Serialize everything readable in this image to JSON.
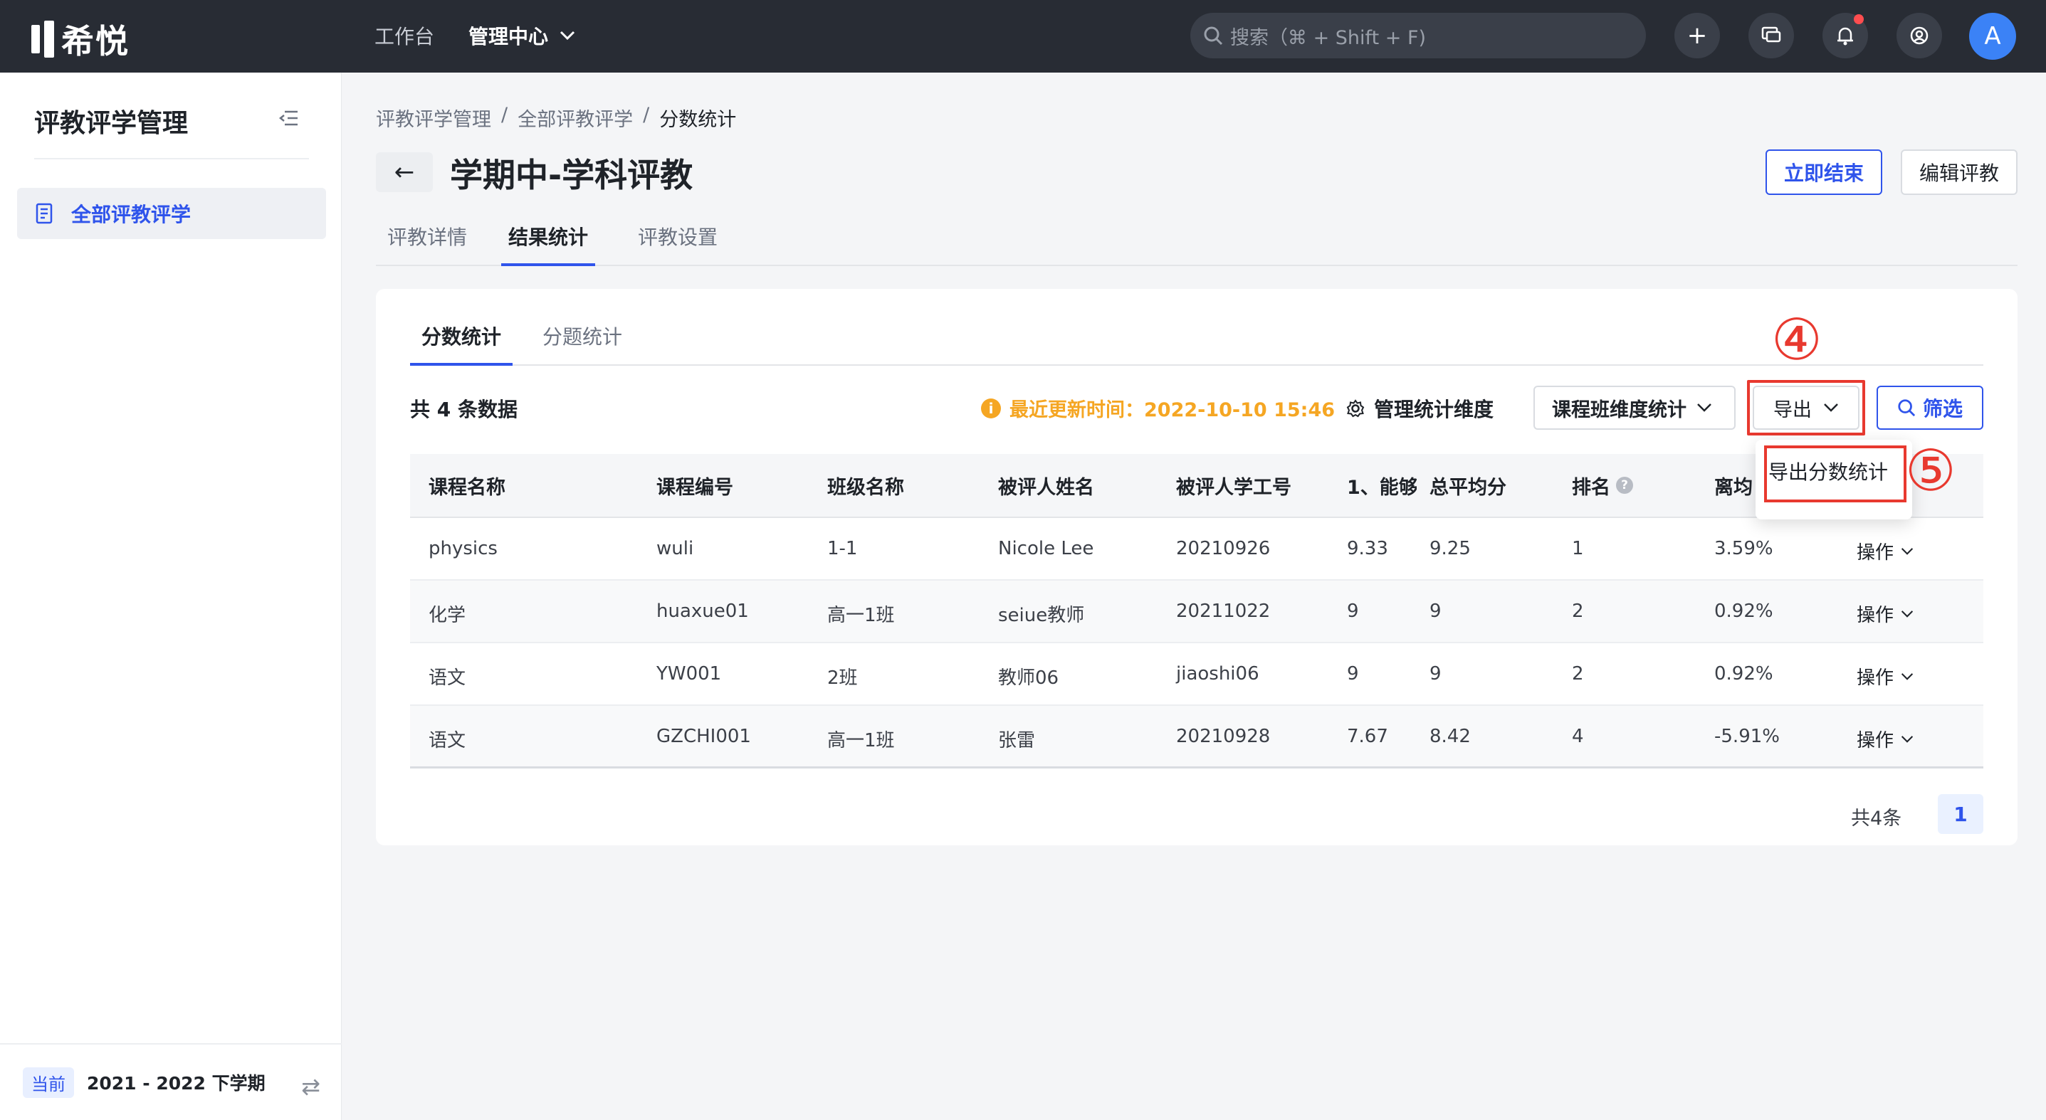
{
  "topbar": {
    "logo_text": "希悦",
    "nav": [
      {
        "label": "工作台"
      },
      {
        "label": "管理中心"
      }
    ],
    "search_placeholder": "搜索（⌘ + Shift + F)",
    "avatar_letter": "A",
    "plus_glyph": "+"
  },
  "sidebar": {
    "title": "评教评学管理",
    "items": [
      {
        "label": "全部评教评学"
      }
    ],
    "footer": {
      "badge": "当前",
      "term": "2021 - 2022 下学期",
      "swap_glyph": "⇄"
    }
  },
  "main": {
    "breadcrumb": [
      "评教评学管理",
      "/",
      "全部评教评学",
      "/",
      "分数统计"
    ],
    "title": "学期中-学科评教",
    "back_glyph": "←",
    "actions": {
      "end_now": "立即结束",
      "edit": "编辑评教"
    },
    "tabs": [
      {
        "label": "评教详情"
      },
      {
        "label": "结果统计"
      },
      {
        "label": "评教设置"
      }
    ],
    "subtabs": [
      {
        "label": "分数统计"
      },
      {
        "label": "分题统计"
      }
    ],
    "toolbar": {
      "count_text": "共 4 条数据",
      "update_label": "最近更新时间：2022-10-10 15:46",
      "info_glyph": "i",
      "manage_dimension": "管理统计维度",
      "dimension_select": "课程班维度统计",
      "export_label": "导出",
      "filter_label": "筛选"
    },
    "export_menu": {
      "item": "导出分数统计"
    },
    "markers": {
      "four": "④",
      "five": "⑤"
    },
    "table": {
      "headers": [
        "课程名称",
        "课程编号",
        "班级名称",
        "被评人姓名",
        "被评人学工号",
        "1、能够",
        "总平均分",
        "排名",
        "离均"
      ],
      "rows": [
        [
          "physics",
          "wuli",
          "1-1",
          "Nicole Lee",
          "20210926",
          "9.33",
          "9.25",
          "1",
          "3.59%",
          "操作"
        ],
        [
          "化学",
          "huaxue01",
          "高一1班",
          "seiue教师",
          "20211022",
          "9",
          "9",
          "2",
          "0.92%",
          "操作"
        ],
        [
          "语文",
          "YW001",
          "2班",
          "教师06",
          "jiaoshi06",
          "9",
          "9",
          "2",
          "0.92%",
          "操作"
        ],
        [
          "语文",
          "GZCHI001",
          "高一1班",
          "张雷",
          "20210928",
          "7.67",
          "8.42",
          "4",
          "-5.91%",
          "操作"
        ]
      ]
    },
    "pagination": {
      "total_text": "共4条",
      "current_page": "1"
    }
  },
  "colors": {
    "primary": "#2f54eb",
    "topbar": "#282c34",
    "warning": "#f5a623",
    "annotation": "#e8392f"
  }
}
